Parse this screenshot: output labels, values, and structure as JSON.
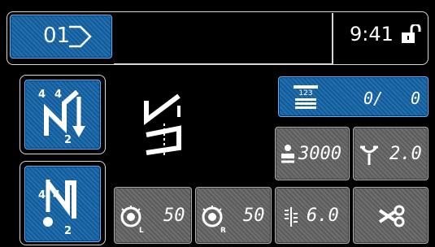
{
  "header": {
    "pattern_number": "01",
    "time": "9:41",
    "lock_icon": "padlock-unlocked-icon"
  },
  "left_buttons": [
    {
      "icon": "reverse-stitch-pattern-icon",
      "top_numbers": [
        "4",
        "4"
      ],
      "bottom_number": "2"
    },
    {
      "icon": "reverse-stitch-tie-icon",
      "top_numbers": [
        "4",
        "4"
      ],
      "bottom_number": "2"
    }
  ],
  "counter": {
    "icon": "bobbin-counter-icon",
    "value": "0/",
    "value2": "0"
  },
  "speed": {
    "icon": "sewing-speed-icon",
    "value": "3000"
  },
  "stitch_length": {
    "icon": "stitch-length-icon",
    "value": "2.0"
  },
  "tension_left": {
    "icon": "thread-tension-left-icon",
    "label": "L",
    "value": "50"
  },
  "tension_right": {
    "icon": "thread-tension-right-icon",
    "label": "R",
    "value": "50"
  },
  "presser": {
    "icon": "presser-foot-pressure-icon",
    "value": "6.0"
  },
  "trimmer": {
    "icon": "thread-trimmer-scissors-icon"
  },
  "colors": {
    "blue": "#1f6fb3",
    "gray": "#666666",
    "frame": "#d8d8d8"
  }
}
